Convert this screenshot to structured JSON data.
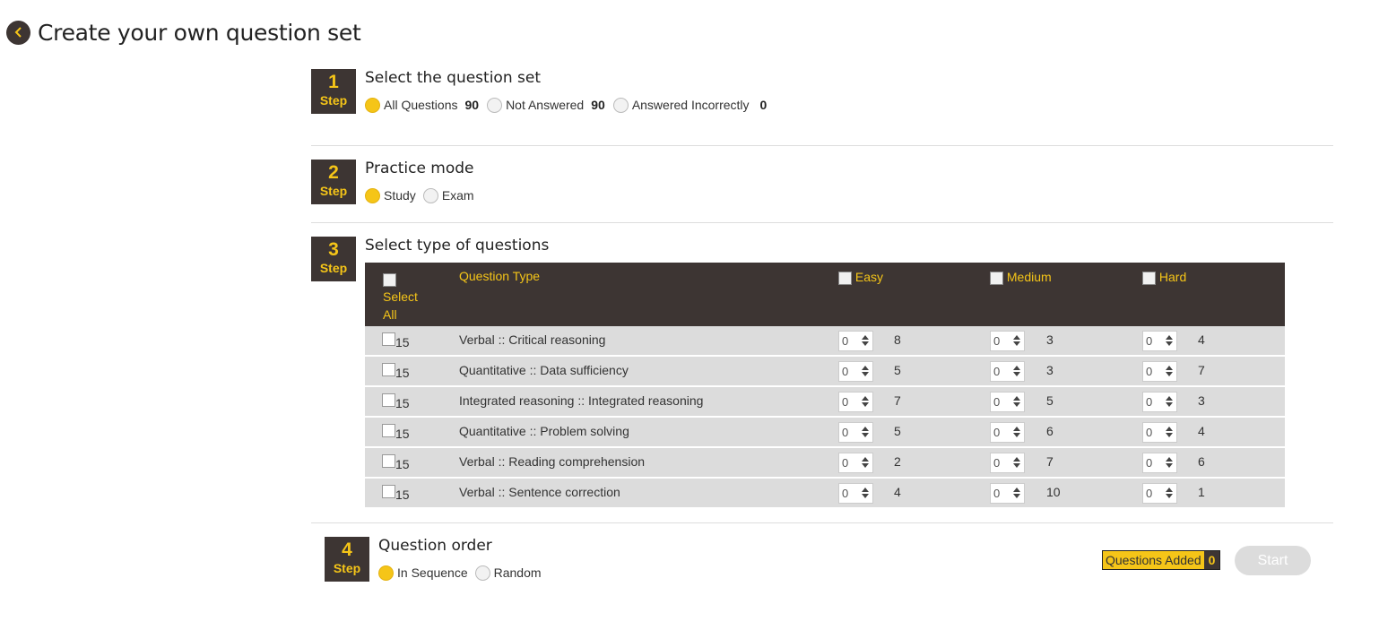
{
  "header": {
    "title": "Create your own question set"
  },
  "step_word": "Step",
  "step1": {
    "number": "1",
    "title": "Select the question set",
    "options": [
      {
        "label": "All Questions",
        "count": "90",
        "selected": true
      },
      {
        "label": "Not Answered",
        "count": "90",
        "selected": false
      },
      {
        "label": "Answered Incorrectly",
        "count": "0",
        "selected": false
      }
    ]
  },
  "step2": {
    "number": "2",
    "title": "Practice mode",
    "options": [
      {
        "label": "Study",
        "selected": true
      },
      {
        "label": "Exam",
        "selected": false
      }
    ]
  },
  "step3": {
    "number": "3",
    "title": "Select type of questions",
    "headers": {
      "select_all_1": "Select",
      "select_all_2": "All",
      "question_type": "Question Type",
      "easy": "Easy",
      "medium": "Medium",
      "hard": "Hard"
    },
    "rows": [
      {
        "total": "15",
        "type": "Verbal :: Critical reasoning",
        "easy_val": "0",
        "easy_avail": "8",
        "medium_val": "0",
        "medium_avail": "3",
        "hard_val": "0",
        "hard_avail": "4"
      },
      {
        "total": "15",
        "type": "Quantitative :: Data sufficiency",
        "easy_val": "0",
        "easy_avail": "5",
        "medium_val": "0",
        "medium_avail": "3",
        "hard_val": "0",
        "hard_avail": "7"
      },
      {
        "total": "15",
        "type": "Integrated reasoning :: Integrated reasoning",
        "easy_val": "0",
        "easy_avail": "7",
        "medium_val": "0",
        "medium_avail": "5",
        "hard_val": "0",
        "hard_avail": "3"
      },
      {
        "total": "15",
        "type": "Quantitative :: Problem solving",
        "easy_val": "0",
        "easy_avail": "5",
        "medium_val": "0",
        "medium_avail": "6",
        "hard_val": "0",
        "hard_avail": "4"
      },
      {
        "total": "15",
        "type": "Verbal :: Reading comprehension",
        "easy_val": "0",
        "easy_avail": "2",
        "medium_val": "0",
        "medium_avail": "7",
        "hard_val": "0",
        "hard_avail": "6"
      },
      {
        "total": "15",
        "type": "Verbal :: Sentence correction",
        "easy_val": "0",
        "easy_avail": "4",
        "medium_val": "0",
        "medium_avail": "10",
        "hard_val": "0",
        "hard_avail": "1"
      }
    ]
  },
  "step4": {
    "number": "4",
    "title": "Question order",
    "options": [
      {
        "label": "In Sequence",
        "selected": true
      },
      {
        "label": "Random",
        "selected": false
      }
    ]
  },
  "footer": {
    "questions_added_label": "Questions Added",
    "questions_added_count": "0",
    "start_label": "Start"
  }
}
